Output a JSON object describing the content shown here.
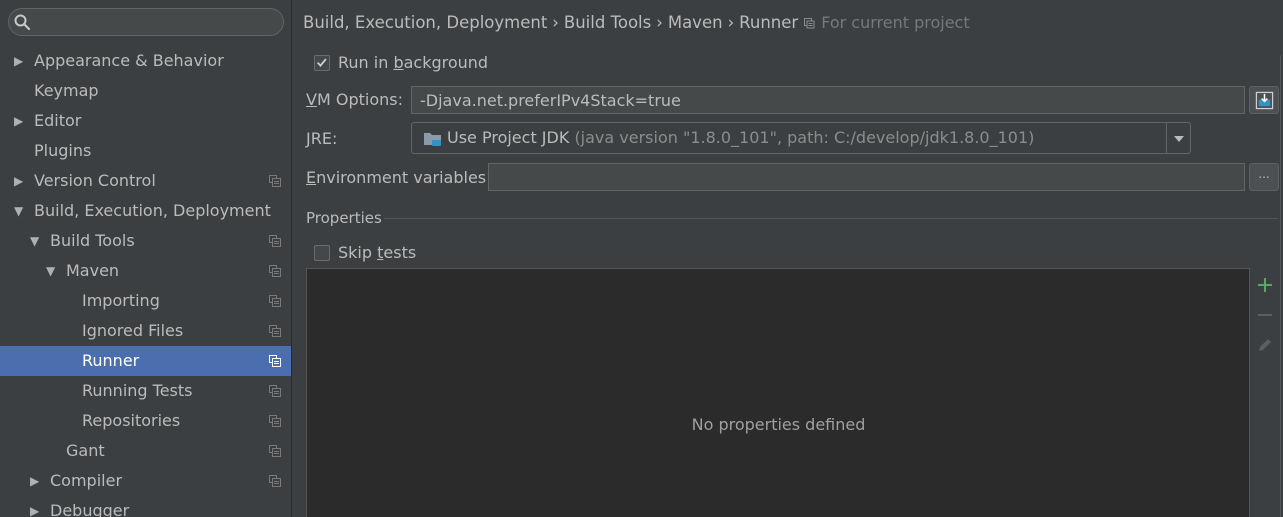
{
  "search": {
    "value": "",
    "placeholder": ""
  },
  "sidebar": {
    "items": [
      {
        "label": "Appearance & Behavior",
        "arrow": "right",
        "level": 0,
        "project_icon": false,
        "selected": false
      },
      {
        "label": "Keymap",
        "arrow": "none",
        "level": 0,
        "project_icon": false,
        "selected": false
      },
      {
        "label": "Editor",
        "arrow": "right",
        "level": 0,
        "project_icon": false,
        "selected": false
      },
      {
        "label": "Plugins",
        "arrow": "none",
        "level": 0,
        "project_icon": false,
        "selected": false
      },
      {
        "label": "Version Control",
        "arrow": "right",
        "level": 0,
        "project_icon": true,
        "selected": false
      },
      {
        "label": "Build, Execution, Deployment",
        "arrow": "down",
        "level": 0,
        "project_icon": false,
        "selected": false
      },
      {
        "label": "Build Tools",
        "arrow": "down",
        "level": 1,
        "project_icon": true,
        "selected": false
      },
      {
        "label": "Maven",
        "arrow": "down",
        "level": 2,
        "project_icon": true,
        "selected": false
      },
      {
        "label": "Importing",
        "arrow": "none",
        "level": 3,
        "project_icon": true,
        "selected": false
      },
      {
        "label": "Ignored Files",
        "arrow": "none",
        "level": 3,
        "project_icon": true,
        "selected": false
      },
      {
        "label": "Runner",
        "arrow": "none",
        "level": 3,
        "project_icon": true,
        "selected": true
      },
      {
        "label": "Running Tests",
        "arrow": "none",
        "level": 3,
        "project_icon": true,
        "selected": false
      },
      {
        "label": "Repositories",
        "arrow": "none",
        "level": 3,
        "project_icon": true,
        "selected": false
      },
      {
        "label": "Gant",
        "arrow": "none",
        "level": 2,
        "project_icon": true,
        "selected": false
      },
      {
        "label": "Compiler",
        "arrow": "right",
        "level": 1,
        "project_icon": true,
        "selected": false
      },
      {
        "label": "Debugger",
        "arrow": "right",
        "level": 1,
        "project_icon": false,
        "selected": false
      }
    ]
  },
  "breadcrumb": {
    "parts": [
      "Build, Execution, Deployment",
      "Build Tools",
      "Maven",
      "Runner"
    ],
    "separator": "›",
    "scope": "For current project"
  },
  "run_in_background": {
    "label_pre": "Run in ",
    "label_mnemonic": "b",
    "label_post": "ackground",
    "checked": true
  },
  "vm_options": {
    "label_mnemonic": "V",
    "label_post": "M Options:",
    "value": "-Djava.net.preferIPv4Stack=true"
  },
  "jre": {
    "label_mnemonic": "J",
    "label_post": "RE:",
    "selected": "Use Project JDK",
    "hint": "(java version \"1.8.0_101\", path: C:/develop/jdk1.8.0_101)"
  },
  "env_vars": {
    "label_mnemonic": "E",
    "label_post": "nvironment variables:",
    "value": "",
    "browse_label": "..."
  },
  "properties": {
    "title": "Properties",
    "skip_tests": {
      "label_pre": "Skip ",
      "label_mnemonic": "t",
      "label_post": "ests",
      "checked": false
    },
    "empty_text": "No properties defined"
  },
  "colors": {
    "background": "#3c3f41",
    "selection": "#4b6eaf",
    "add_green": "#59a869",
    "table_bg": "#2b2b2b"
  }
}
